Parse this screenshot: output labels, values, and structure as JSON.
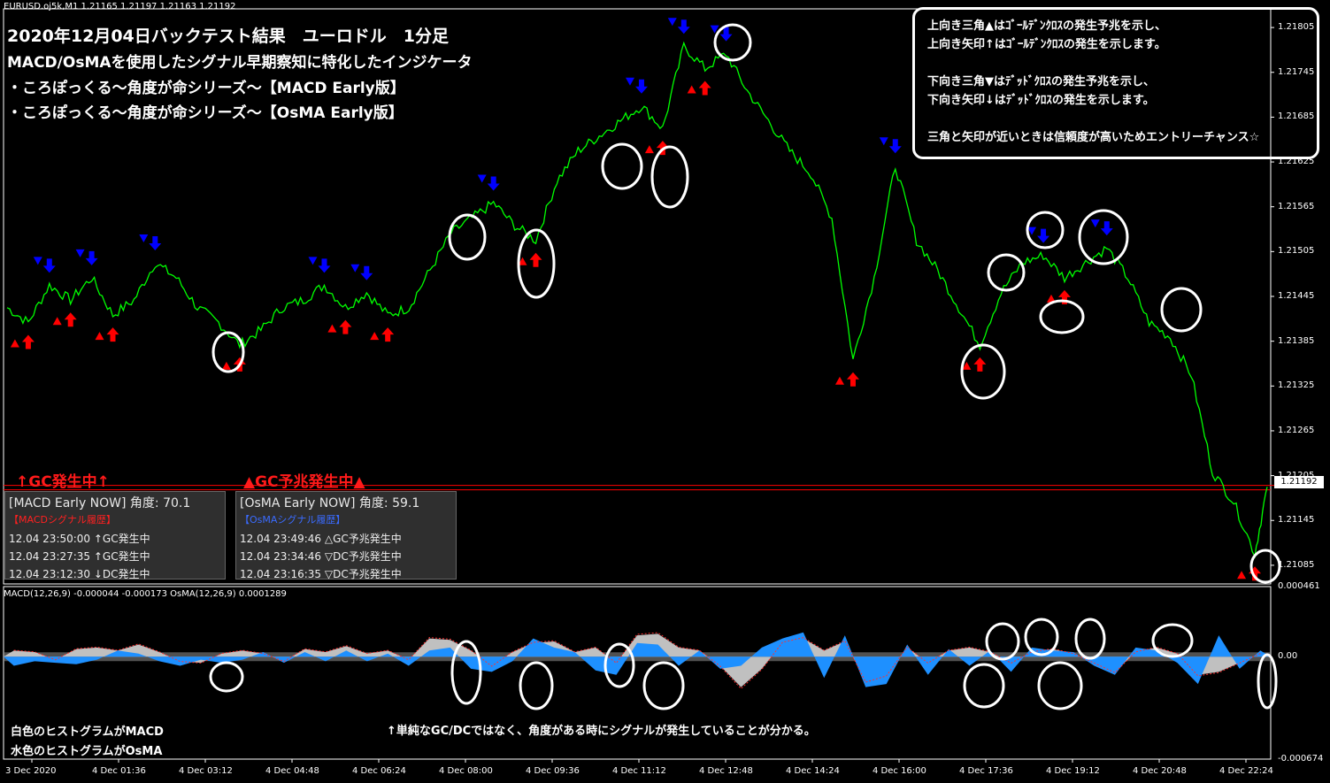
{
  "header": {
    "symbol_line": "EURUSD.oj5k,M1  1.21165 1.21197 1.21163 1.21192"
  },
  "overlay": {
    "title": "2020年12月04日バックテスト結果　ユーロドル　1分足",
    "subtitle": "MACD/OsMAを使用したシグナル早期察知に特化したインジケータ",
    "line1": "・ころぽっくる～角度が命シリーズ～【MACD Early版】",
    "line2": "・ころぽっくる～角度が命シリーズ～【OsMA Early版】"
  },
  "legend": {
    "line1": "上向き三角▲はｺﾞｰﾙﾃﾞﾝｸﾛｽの発生予兆を示し、",
    "line2": "上向き矢印↑はｺﾞｰﾙﾃﾞﾝｸﾛｽの発生を示します。",
    "line3": "下向き三角▼はﾃﾞｯﾄﾞｸﾛｽの発生予兆を示し、",
    "line4": "下向き矢印↓はﾃﾞｯﾄﾞｸﾛｽの発生を示します。",
    "line5": "三角と矢印が近いときは信頼度が高いためエントリーチャンス☆"
  },
  "status": {
    "left": "↑GC発生中↑",
    "right": "▲GC予兆発生中▲"
  },
  "panel_macd": {
    "header": "[MACD Early NOW] 角度: 70.1",
    "sub": "【MACDシグナル履歴】",
    "rows": [
      "12.04 23:50:00 ↑GC発生中",
      "12.04 23:27:35 ↑GC発生中",
      "12.04 23:12:30 ↓DC発生中"
    ]
  },
  "panel_osma": {
    "header": "[OsMA Early NOW] 角度: 59.1",
    "sub": "【OsMAシグナル履歴】",
    "rows": [
      "12.04 23:49:46 △GC予兆発生中",
      "12.04 23:34:46 ▽DC予兆発生中",
      "12.04 23:16:35 ▽DC予兆発生中"
    ]
  },
  "subwindow": {
    "label": "MACD(12,26,9) -0.000044 -0.000173  OsMA(12,26,9) 0.0001289",
    "note_white": "白色のヒストグラムがMACD",
    "note_blue": "水色のヒストグラムがOsMA",
    "note_center": "↑単純なGC/DCではなく、角度がある時にシグナルが発生していることが分かる。"
  },
  "colors": {
    "price_line": "#00ff00",
    "up_arrow": "#ff0000",
    "down_arrow": "#0000ff",
    "macd_hist": "#c0c0c0",
    "osma_hist": "#1e90ff",
    "current_price_line": "#ff0000",
    "circle": "#ffffff"
  },
  "chart_data": [
    {
      "type": "line",
      "name": "EURUSD M1 price",
      "current_price": "1.21192",
      "yticks": [
        "1.21805",
        "1.21745",
        "1.21685",
        "1.21625",
        "1.21565",
        "1.21505",
        "1.21445",
        "1.21385",
        "1.21325",
        "1.21265",
        "1.21205",
        "1.21145",
        "1.21085"
      ],
      "ylim": [
        1.2106,
        1.2183
      ],
      "xticks": [
        "3 Dec 2020",
        "4 Dec 01:36",
        "4 Dec 03:12",
        "4 Dec 04:48",
        "4 Dec 06:24",
        "4 Dec 08:00",
        "4 Dec 09:36",
        "4 Dec 11:12",
        "4 Dec 12:48",
        "4 Dec 14:24",
        "4 Dec 16:00",
        "4 Dec 17:36",
        "4 Dec 19:12",
        "4 Dec 20:48",
        "4 Dec 22:24"
      ],
      "x": [
        0,
        24,
        48,
        72,
        96,
        120,
        144,
        168,
        192,
        216,
        240,
        264,
        288,
        312,
        336,
        360,
        384,
        408,
        432,
        456,
        480,
        504,
        528,
        552,
        576,
        600,
        624,
        648,
        672,
        696,
        720,
        744,
        768,
        792,
        816,
        840,
        864,
        888,
        912,
        936,
        960,
        984,
        1008,
        1032,
        1056,
        1080,
        1104,
        1128,
        1152,
        1176,
        1200,
        1224,
        1248,
        1272,
        1296,
        1320,
        1344,
        1368,
        1392,
        1416,
        1430
      ],
      "values": [
        1.2143,
        1.2141,
        1.2146,
        1.2144,
        1.2147,
        1.2142,
        1.2144,
        1.2149,
        1.2147,
        1.2143,
        1.2141,
        1.2138,
        1.214,
        1.2143,
        1.2144,
        1.2146,
        1.2143,
        1.2145,
        1.2142,
        1.2143,
        1.2148,
        1.2153,
        1.2155,
        1.2157,
        1.2154,
        1.2152,
        1.216,
        1.2164,
        1.2166,
        1.2168,
        1.217,
        1.2167,
        1.2178,
        1.2175,
        1.2177,
        1.2172,
        1.2168,
        1.2164,
        1.2161,
        1.2155,
        1.2136,
        1.2147,
        1.2162,
        1.2152,
        1.2148,
        1.2143,
        1.2138,
        1.2145,
        1.2149,
        1.215,
        1.2147,
        1.2149,
        1.2151,
        1.2147,
        1.2141,
        1.2139,
        1.2134,
        1.2121,
        1.2117,
        1.211,
        1.2119
      ]
    },
    {
      "type": "bar",
      "name": "MACD(12,26,9) / OsMA(12,26,9) histogram",
      "yticks": [
        "0.000461",
        "0.00",
        "-0.000674"
      ],
      "ylim": [
        -0.000674,
        0.000461
      ],
      "series": [
        {
          "name": "MACD",
          "values": [
            4e-05,
            3e-05,
            -2e-05,
            5e-05,
            6e-05,
            4e-05,
            8e-05,
            3e-05,
            -3e-05,
            -4e-05,
            2e-05,
            4e-05,
            2e-05,
            -3e-05,
            5e-05,
            3e-05,
            7e-05,
            2e-05,
            4e-05,
            -2e-05,
            0.00012,
            0.00011,
            4e-05,
            -6e-05,
            3e-05,
            9e-05,
            0.0001,
            3e-05,
            6e-05,
            -4e-05,
            0.00014,
            0.00015,
            6e-05,
            4e-05,
            -6e-05,
            -0.0002,
            -8e-05,
            9e-05,
            0.00012,
            4e-05,
            0.0001,
            -0.00016,
            -0.00012,
            6e-05,
            -4e-05,
            4e-05,
            6e-05,
            3e-05,
            -4e-05,
            3e-05,
            5e-05,
            2e-05,
            -4e-05,
            -0.0001,
            3e-05,
            6e-05,
            2e-05,
            -0.00012,
            -0.0001,
            -4e-05,
            2e-05
          ]
        },
        {
          "name": "OsMA",
          "values": [
            -6e-05,
            -3e-05,
            -4e-05,
            -5e-05,
            -2e-05,
            4e-05,
            2e-05,
            -3e-05,
            -6e-05,
            -2e-05,
            -4e-05,
            -2e-05,
            3e-05,
            -4e-05,
            3e-05,
            -3e-05,
            4e-05,
            -3e-05,
            2e-05,
            -6e-05,
            4e-05,
            6e-05,
            -8e-05,
            -0.0001,
            -3e-05,
            0.00012,
            6e-05,
            3e-05,
            -9e-05,
            -0.00012,
            9e-05,
            8e-05,
            -6e-05,
            4e-05,
            -8e-05,
            -6e-05,
            6e-05,
            0.00012,
            0.00016,
            -0.00014,
            0.00014,
            -0.0002,
            -0.00018,
            8e-05,
            -0.00012,
            5e-05,
            -6e-05,
            4e-05,
            -0.0001,
            6e-05,
            4e-05,
            3e-05,
            -6e-05,
            -0.00012,
            6e-05,
            4e-05,
            -4e-05,
            -0.00018,
            0.00014,
            -8e-05,
            4e-05
          ]
        }
      ]
    }
  ]
}
